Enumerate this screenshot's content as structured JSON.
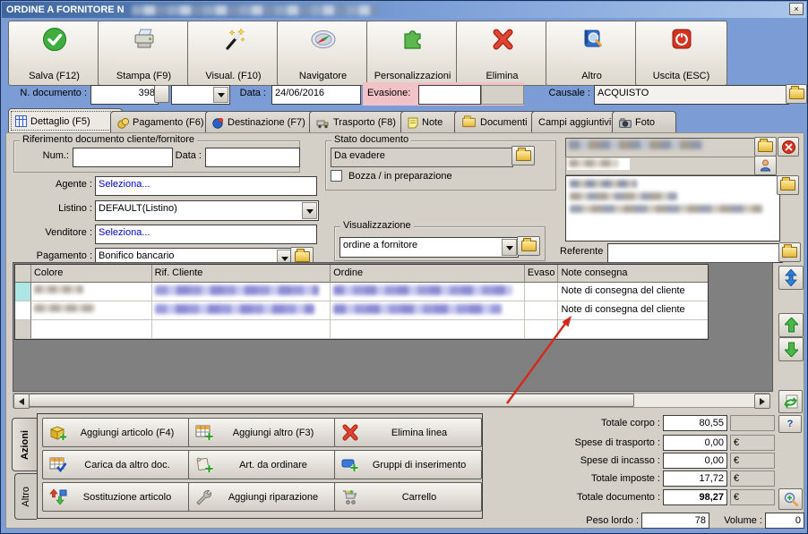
{
  "window": {
    "title": "ORDINE A FORNITORE N",
    "close": "×"
  },
  "toolbar": {
    "buttons": [
      {
        "label": "Salva (F12)",
        "icon": "save-check-icon"
      },
      {
        "label": "Stampa (F9)",
        "icon": "printer-icon"
      },
      {
        "label": "Visual. (F10)",
        "icon": "magic-wand-icon"
      },
      {
        "label": "Navigatore",
        "icon": "compass-icon"
      },
      {
        "label": "Personalizzazioni",
        "icon": "puzzle-icon"
      },
      {
        "label": "Elimina",
        "icon": "red-x-icon"
      },
      {
        "label": "Altro",
        "icon": "book-search-icon"
      },
      {
        "label": "Uscita (ESC)",
        "icon": "power-icon"
      }
    ]
  },
  "doc": {
    "n_label": "N. documento :",
    "n_value": "398",
    "data_label": "Data :",
    "data_value": "24/06/2016",
    "evasione_label": "Evasione:",
    "causale_label": "Causale :",
    "causale_value": "ACQUISTO"
  },
  "tabs": [
    "Dettaglio (F5)",
    "Pagamento (F6)",
    "Destinazione (F7)",
    "Trasporto (F8)",
    "Note",
    "Documenti",
    "Campi aggiuntivi",
    "Foto"
  ],
  "form": {
    "group_title": "Riferimento documento cliente/fornitore",
    "num_label": "Num.:",
    "num_value": "",
    "data_label": "Data :",
    "data_value": "",
    "agente_label": "Agente :",
    "agente_value": "Seleziona...",
    "listino_label": "Listino :",
    "listino_value": "DEFAULT(Listino)",
    "venditore_label": "Venditore :",
    "venditore_value": "Seleziona...",
    "pagamento_label": "Pagamento :",
    "pagamento_value": "Bonifico bancario"
  },
  "stato": {
    "title": "Stato documento",
    "value": "Da evadere",
    "bozza": "Bozza / in preparazione"
  },
  "vis": {
    "title": "Visualizzazione",
    "value": "ordine a fornitore"
  },
  "referente": {
    "label": "Referente",
    "value": ""
  },
  "grid": {
    "headers": [
      "",
      "Colore",
      "Rif. Cliente",
      "Ordine",
      "Evaso",
      "Note consegna"
    ],
    "rows": [
      {
        "note": "Note di consegna del cliente"
      },
      {
        "note": "Note di consegna del cliente"
      }
    ]
  },
  "actions": {
    "tab_azioni": "Azioni",
    "tab_altro": "Altro",
    "buttons": [
      {
        "label": "Aggiungi articolo (F4)",
        "icon": "box-add-icon"
      },
      {
        "label": "Aggiungi altro (F3)",
        "icon": "grid-add-icon"
      },
      {
        "label": "Elimina linea",
        "icon": "red-x-icon"
      },
      {
        "label": "Carica da altro doc.",
        "icon": "grid-check-icon"
      },
      {
        "label": "Art. da ordinare",
        "icon": "scroll-add-icon"
      },
      {
        "label": "Gruppi di inserimento",
        "icon": "group-add-icon"
      },
      {
        "label": "Sostituzione articolo",
        "icon": "swap-arrows-icon"
      },
      {
        "label": "Aggiungi riparazione",
        "icon": "wrench-icon"
      },
      {
        "label": "Carrello",
        "icon": "cart-icon"
      }
    ]
  },
  "totals": {
    "rows": [
      {
        "label": "Totale corpo :",
        "value": "80,55",
        "cur": ""
      },
      {
        "label": "Spese di trasporto :",
        "value": "0,00",
        "cur": "€"
      },
      {
        "label": "Spese di incasso :",
        "value": "0,00",
        "cur": "€"
      },
      {
        "label": "Totale imposte :",
        "value": "17,72",
        "cur": "€"
      },
      {
        "label": "Totale documento :",
        "value": "98,27",
        "cur": "€"
      }
    ],
    "help": "?",
    "peso_label": "Peso lordo :",
    "peso_value": "78",
    "volume_label": "Volume :",
    "volume_value": "0"
  },
  "colors": {
    "window_blue": "#7c9cd6",
    "panel_gray": "#d4d0c8",
    "grid_gray": "#808080",
    "evasione_pink": "#f2c3c6",
    "selected_cell_cyan": "#aee6e6",
    "link_blue": "#0000d8",
    "arrow_red": "#d42a1e"
  }
}
